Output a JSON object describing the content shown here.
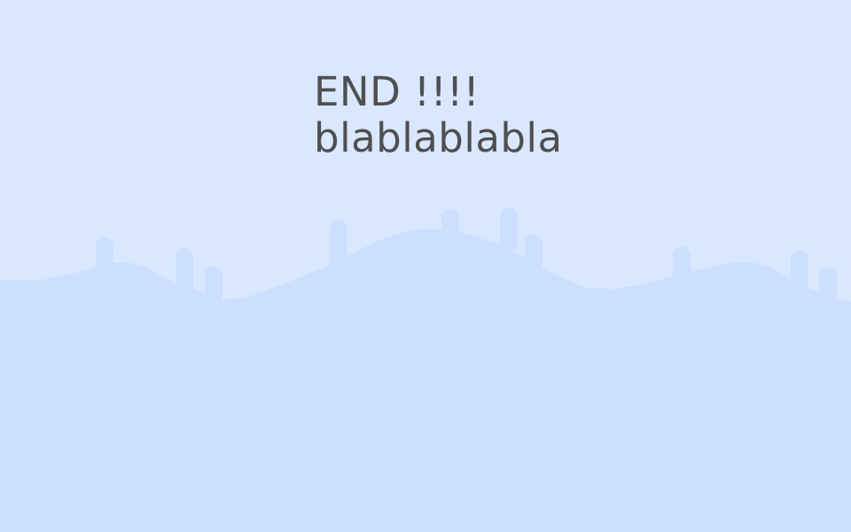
{
  "screen": {
    "name": "end-screen",
    "background_color": "#d9e8ff",
    "ground_color": "#cddfff",
    "text_color": "#4f4f52"
  },
  "message": {
    "line1": "END !!!!",
    "line2": "blablablabla"
  },
  "scenery": {
    "icon": "hill-with-towers-silhouette"
  }
}
